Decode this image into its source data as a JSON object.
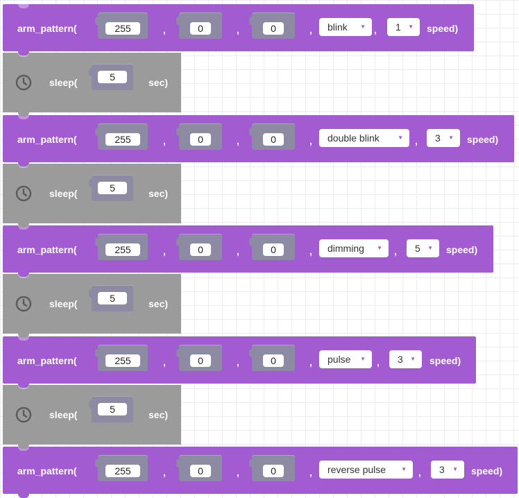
{
  "arm_blocks": [
    {
      "func": "arm_pattern(",
      "r": "255",
      "g": "0",
      "b": "0",
      "pattern": "blink",
      "speed_value": "1",
      "speed_label": "speed)"
    },
    {
      "func": "arm_pattern(",
      "r": "255",
      "g": "0",
      "b": "0",
      "pattern": "double  blink",
      "speed_value": "3",
      "speed_label": "speed)"
    },
    {
      "func": "arm_pattern(",
      "r": "255",
      "g": "0",
      "b": "0",
      "pattern": "dimming",
      "speed_value": "5",
      "speed_label": "speed)"
    },
    {
      "func": "arm_pattern(",
      "r": "255",
      "g": "0",
      "b": "0",
      "pattern": "pulse",
      "speed_value": "3",
      "speed_label": "speed)"
    },
    {
      "func": "arm_pattern(",
      "r": "255",
      "g": "0",
      "b": "0",
      "pattern": "reverse  pulse",
      "speed_value": "3",
      "speed_label": "speed)"
    }
  ],
  "sleep_blocks": [
    {
      "func": "sleep(",
      "value": "5",
      "unit": "sec)",
      "icon": "clock-icon"
    },
    {
      "func": "sleep(",
      "value": "5",
      "unit": "sec)",
      "icon": "clock-icon"
    },
    {
      "func": "sleep(",
      "value": "5",
      "unit": "sec)",
      "icon": "clock-icon"
    },
    {
      "func": "sleep(",
      "value": "5",
      "unit": "sec)",
      "icon": "clock-icon"
    }
  ],
  "separator": ",",
  "dropdown_caret": "▼",
  "colors": {
    "arm_block": "#a25bd1",
    "sleep_block": "#9b9b9b",
    "socket": "#8d8aa3",
    "grid": "#ececf0"
  }
}
